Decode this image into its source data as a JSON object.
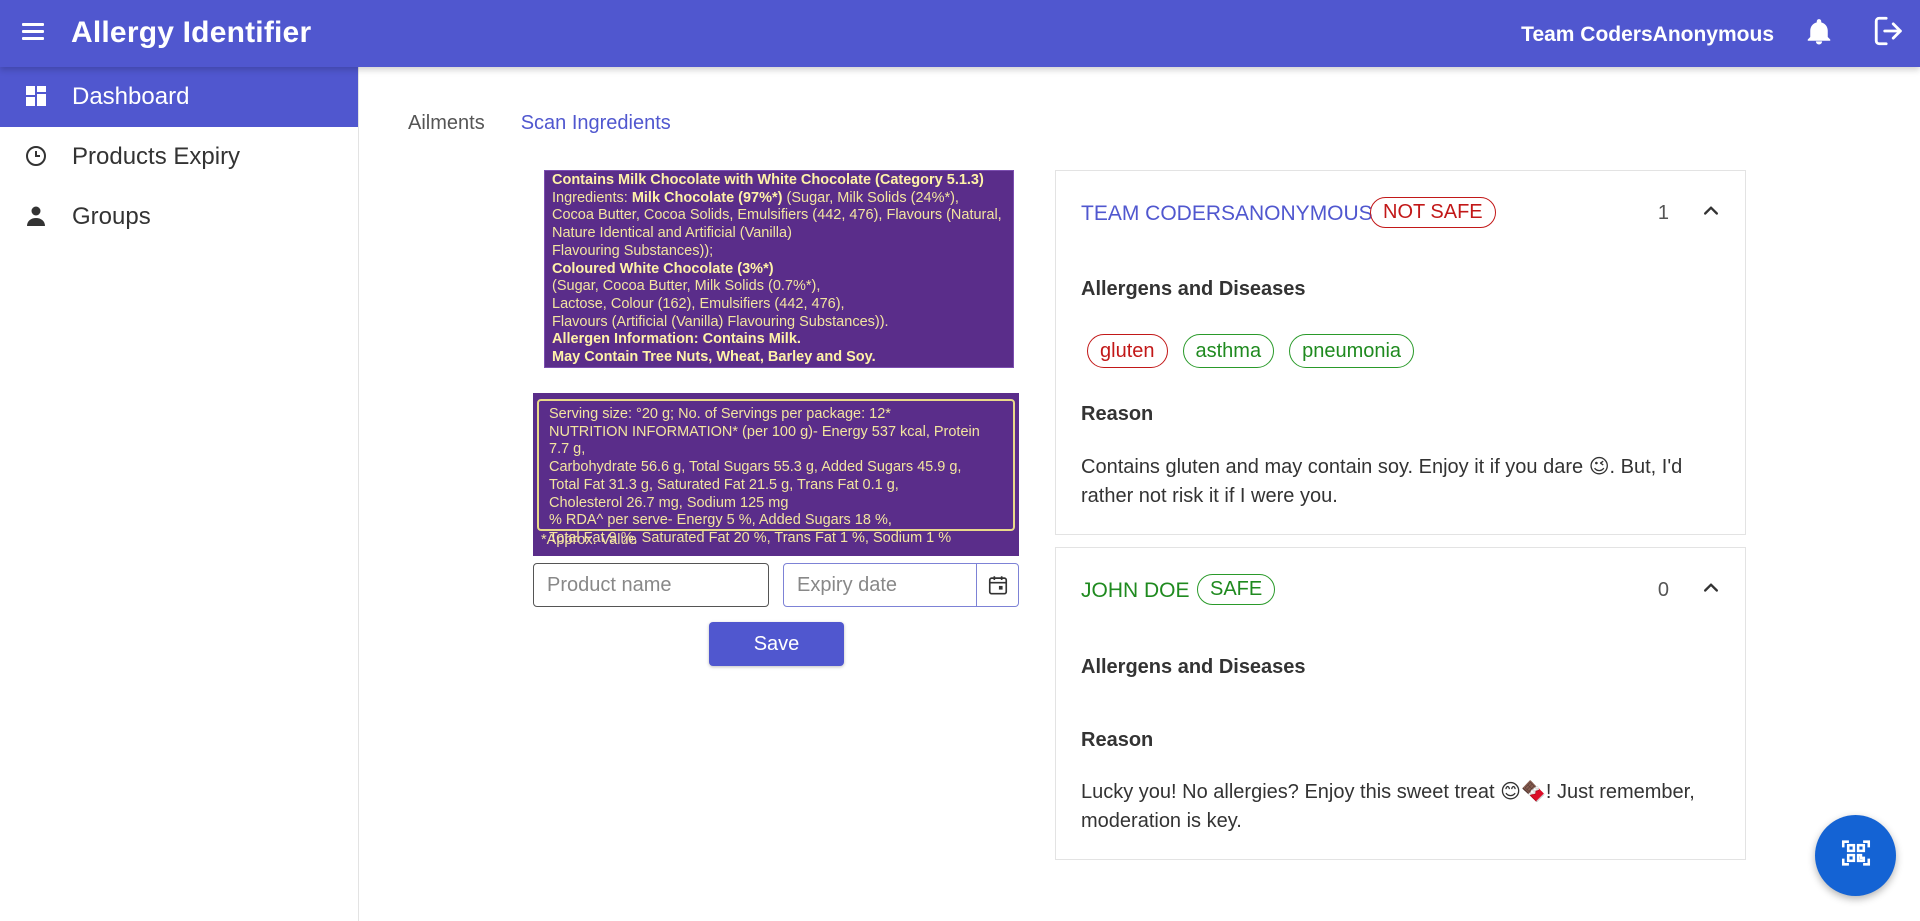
{
  "header": {
    "title": "Allergy Identifier",
    "team": "Team CodersAnonymous"
  },
  "sidebar": {
    "items": [
      {
        "label": "Dashboard",
        "icon": "dashboard-icon",
        "active": true
      },
      {
        "label": "Products Expiry",
        "icon": "clock-icon",
        "active": false
      },
      {
        "label": "Groups",
        "icon": "person-icon",
        "active": false
      }
    ]
  },
  "tabs": [
    {
      "label": "Ailments",
      "active": false
    },
    {
      "label": "Scan Ingredients",
      "active": true
    }
  ],
  "label_image_1": {
    "lines": [
      {
        "bold": "Contains Milk Chocolate with White Chocolate (Category 5.1.3)",
        "text": ""
      },
      {
        "pre": "Ingredients: ",
        "bold": "Milk Chocolate (97%*)",
        "text": " (Sugar, Milk Solids (24%*),"
      },
      {
        "text": "Cocoa Butter, Cocoa Solids, Emulsifiers (442, 476), Flavours (Natural,"
      },
      {
        "text": "Nature Identical and Artificial (Vanilla)"
      },
      {
        "text": "Flavouring Substances));"
      },
      {
        "bold": "Coloured White Chocolate (3%*)",
        "text": ""
      },
      {
        "text": "(Sugar, Cocoa Butter, Milk Solids (0.7%*),"
      },
      {
        "text": "Lactose, Colour (162), Emulsifiers (442, 476),"
      },
      {
        "text": "Flavours (Artificial (Vanilla) Flavouring Substances))."
      },
      {
        "bold": "Allergen Information: Contains Milk.",
        "text": ""
      },
      {
        "bold": "May Contain Tree Nuts, Wheat, Barley and Soy.",
        "text": ""
      }
    ]
  },
  "label_image_2": {
    "lines": [
      "Serving size: °20 g; No. of Servings per package: 12*",
      "NUTRITION INFORMATION* (per 100 g)- Energy 537 kcal, Protein 7.7 g,",
      "Carbohydrate 56.6 g, Total Sugars 55.3 g, Added Sugars 45.9 g,",
      "Total Fat 31.3 g, Saturated Fat 21.5 g, Trans Fat 0.1 g,",
      "Cholesterol 26.7 mg, Sodium 125 mg",
      "% RDA^ per serve- Energy 5 %, Added Sugars 18 %,",
      "Total Fat 9 %, Saturated Fat 20 %, Trans Fat 1 %, Sodium 1 %"
    ],
    "footnote": "*Approx. Value"
  },
  "form": {
    "product_placeholder": "Product name",
    "expiry_placeholder": "Expiry date",
    "save_label": "Save"
  },
  "results": [
    {
      "name": "TEAM CODERSANONYMOUS",
      "status": "NOT SAFE",
      "count": "1",
      "allergens_title": "Allergens and Diseases",
      "allergens": [
        {
          "label": "gluten",
          "color": "red"
        },
        {
          "label": "asthma",
          "color": "green"
        },
        {
          "label": "pneumonia",
          "color": "green"
        }
      ],
      "reason_title": "Reason",
      "reason": "Contains gluten and may contain soy. Enjoy it if you dare 😉. But, I'd rather not risk it if I were you."
    },
    {
      "name": "JOHN DOE",
      "status": "SAFE",
      "count": "0",
      "allergens_title": "Allergens and Diseases",
      "allergens": [],
      "reason_title": "Reason",
      "reason": "Lucky you! No allergies? Enjoy this sweet treat 😊🍫! Just remember, moderation is key."
    }
  ],
  "colors": {
    "primary": "#5057cf",
    "danger": "#c21818",
    "success": "#1f8a1f",
    "fab": "#1463d4"
  }
}
